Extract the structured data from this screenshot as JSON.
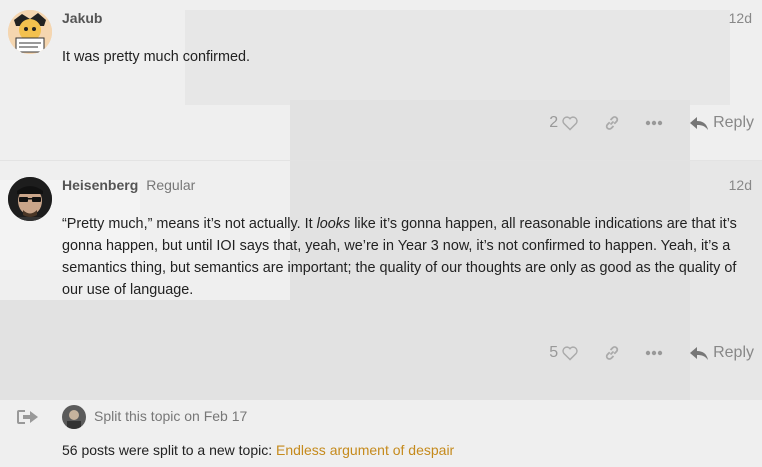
{
  "posts": [
    {
      "username": "Jakub",
      "user_title": "",
      "date": "12d",
      "body_html": "It was pretty much confirmed.",
      "likes": "2",
      "reply_label": "Reply",
      "avatar_icon": "cartoon-avatar-icon"
    },
    {
      "username": "Heisenberg",
      "user_title": "Regular",
      "date": "12d",
      "body_before": "“Pretty much,” means it’s not actually. It ",
      "body_em": "looks",
      "body_after": " like it’s gonna happen, all reasonable indications are that it’s gonna happen, but until IOI says that, yeah, we’re in Year 3 now, it’s not confirmed to happen. Yeah, it’s a semantics thing, but semantics are important; the quality of our thoughts are only as good as the quality of our use of language.",
      "likes": "5",
      "reply_label": "Reply",
      "avatar_icon": "sunglasses-avatar-icon"
    }
  ],
  "small_action": {
    "description": "Split this topic on Feb 17",
    "note_prefix": "56 posts were split to a new topic: ",
    "link_text": "Endless argument of despair",
    "icon": "split-arrow-icon"
  },
  "colors": {
    "link": "#c58a1c",
    "background": "#efefef"
  }
}
